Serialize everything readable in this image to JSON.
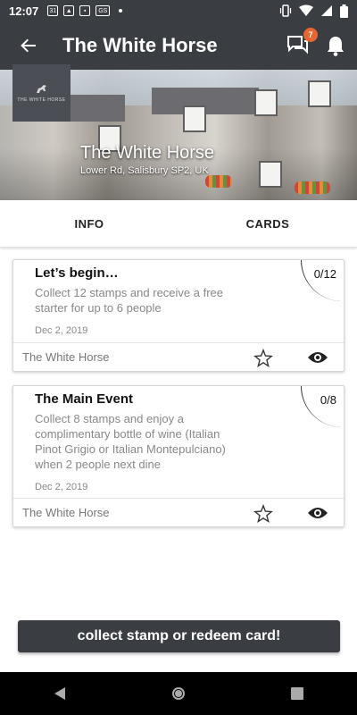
{
  "status_bar": {
    "time": "12:07",
    "left_icons": [
      "calendar-icon",
      "photo-icon",
      "contact-icon",
      "gs-icon"
    ],
    "right_icons": [
      "vibrate-icon",
      "wifi-icon",
      "signal-icon",
      "battery-icon"
    ]
  },
  "app_bar": {
    "title": "The White Horse",
    "message_badge": "7"
  },
  "hero": {
    "logo_text": "THE WHITE HORSE",
    "venue_name": "The White Horse",
    "address": "Lower Rd, Salisbury SP2, UK"
  },
  "tabs": [
    "INFO",
    "CARDS"
  ],
  "cards": [
    {
      "title": "Let’s begin…",
      "description": "Collect 12 stamps and receive a free starter for up to 6 people",
      "date": "Dec 2, 2019",
      "count": "0/12",
      "venue": "The White Horse"
    },
    {
      "title": "The Main Event",
      "description": "Collect 8 stamps and enjoy a complimentary bottle of wine (Italian Pinot Grigio or Italian Montepulciano) when 2 people next dine",
      "date": "Dec 2, 2019",
      "count": "0/8",
      "venue": "The White Horse"
    }
  ],
  "action_button": "collect stamp or redeem card!",
  "colors": {
    "bar": "#3a3d42",
    "badge": "#e8662f",
    "nav": "#000000"
  }
}
